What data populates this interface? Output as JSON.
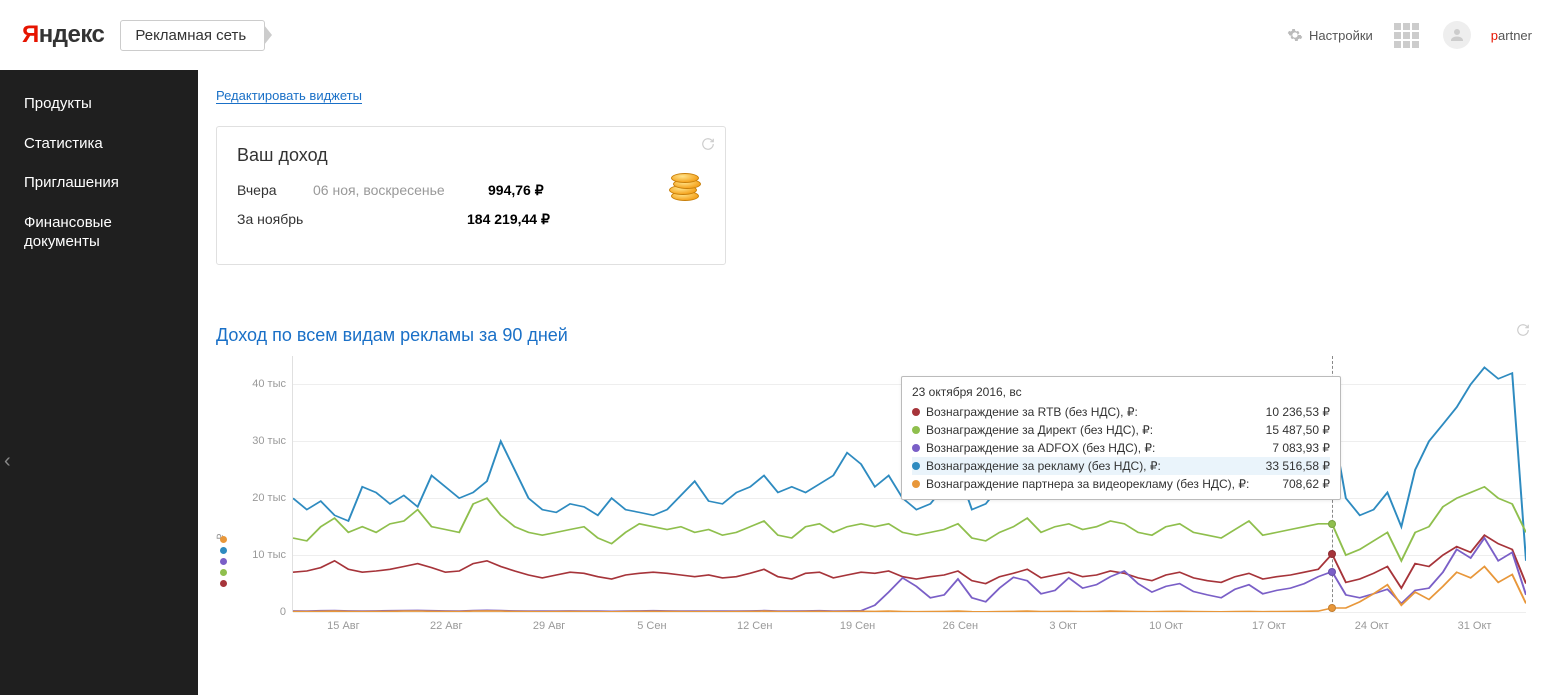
{
  "header": {
    "logo_prefix": "Я",
    "logo_rest": "ндекс",
    "service": "Рекламная сеть",
    "settings_label": "Настройки",
    "username_prefix": "p",
    "username_rest": "artner"
  },
  "sidebar": {
    "items": [
      {
        "label": "Продукты"
      },
      {
        "label": "Статистика"
      },
      {
        "label": "Приглашения"
      },
      {
        "label": "Финансовые документы"
      }
    ]
  },
  "content": {
    "edit_widgets": "Редактировать виджеты",
    "income": {
      "title": "Ваш доход",
      "rows": [
        {
          "label": "Вчера",
          "date": "06 ноя, воскресенье",
          "value": "994,76 ₽"
        },
        {
          "label": "За ноябрь",
          "date": "",
          "value": "184 219,44 ₽"
        }
      ]
    }
  },
  "chart_data": {
    "type": "line",
    "title": "Доход по всем видам рекламы за 90 дней",
    "ylabel": "₽",
    "ylim": [
      0,
      45000
    ],
    "y_ticks": [
      0,
      10000,
      20000,
      30000,
      40000
    ],
    "y_tick_labels": [
      "0",
      "10 тыс",
      "20 тыс",
      "30 тыс",
      "40 тыс"
    ],
    "x_tick_labels": [
      "15 Авг",
      "22 Авг",
      "29 Авг",
      "5 Сен",
      "12 Сен",
      "19 Сен",
      "26 Сен",
      "3 Окт",
      "10 Окт",
      "17 Окт",
      "24 Окт",
      "31 Окт"
    ],
    "hover_index": 75,
    "tooltip": {
      "date": "23 октября 2016, вс",
      "rows": [
        {
          "color": "#a6343a",
          "name": "Вознаграждение за RTB (без НДС), ₽:",
          "value": "10 236,53 ₽"
        },
        {
          "color": "#8fbf4d",
          "name": "Вознаграждение за Директ (без НДС), ₽:",
          "value": "15 487,50 ₽"
        },
        {
          "color": "#7a5fc7",
          "name": "Вознаграждение за ADFOX (без НДС), ₽:",
          "value": "7 083,93 ₽"
        },
        {
          "color": "#2e8bc0",
          "name": "Вознаграждение за рекламу (без НДС), ₽:",
          "value": "33 516,58 ₽",
          "highlight": true
        },
        {
          "color": "#e8973a",
          "name": "Вознаграждение партнера за видеорекламу (без НДС), ₽:",
          "value": "708,62 ₽"
        }
      ]
    },
    "series": [
      {
        "name": "Вознаграждение за рекламу (без НДС)",
        "color": "#2e8bc0",
        "values": [
          20000,
          18000,
          19500,
          17000,
          16000,
          22000,
          21000,
          19000,
          20500,
          18500,
          24000,
          22000,
          20000,
          21000,
          23000,
          30000,
          25000,
          20000,
          18000,
          17500,
          19000,
          18500,
          17000,
          20000,
          18000,
          17500,
          17000,
          18000,
          20500,
          23000,
          19500,
          19000,
          21000,
          22000,
          24000,
          21000,
          22000,
          21000,
          22500,
          24000,
          28000,
          26000,
          22000,
          24000,
          20000,
          18000,
          19000,
          22000,
          25000,
          18000,
          19000,
          22000,
          24500,
          21000,
          20000,
          22000,
          23000,
          28000,
          23000,
          21000,
          22500,
          24000,
          26000,
          21500,
          20500,
          21500,
          24000,
          25000,
          23000,
          22000,
          24000,
          26000,
          25000,
          27000,
          29000,
          33500,
          20000,
          17000,
          18000,
          21000,
          15000,
          25000,
          30000,
          33000,
          36000,
          40000,
          43000,
          41000,
          42000,
          9000
        ]
      },
      {
        "name": "Вознаграждение за Директ (без НДС)",
        "color": "#8fbf4d",
        "values": [
          13000,
          12500,
          15000,
          16500,
          14000,
          15000,
          14000,
          15500,
          16000,
          18000,
          15000,
          14500,
          14000,
          19000,
          20000,
          17000,
          15000,
          14000,
          13500,
          14000,
          14500,
          15000,
          13000,
          12000,
          14000,
          15500,
          15000,
          14500,
          15000,
          14000,
          14500,
          13500,
          14000,
          15000,
          16000,
          13500,
          13000,
          15000,
          15500,
          14000,
          15000,
          15500,
          15000,
          15500,
          14000,
          13500,
          14000,
          14500,
          15500,
          13000,
          12500,
          14000,
          15000,
          16500,
          14000,
          15000,
          15500,
          14500,
          15000,
          16000,
          15500,
          14000,
          13500,
          15000,
          15500,
          14000,
          13500,
          13000,
          14500,
          16000,
          13500,
          14000,
          14500,
          15000,
          15500,
          15500,
          10000,
          11000,
          12500,
          14000,
          9000,
          14000,
          15000,
          18500,
          20000,
          21000,
          22000,
          20000,
          19000,
          14000
        ]
      },
      {
        "name": "Вознаграждение за RTB (без НДС)",
        "color": "#a6343a",
        "values": [
          7000,
          7200,
          7800,
          9000,
          7500,
          7000,
          7200,
          7500,
          8000,
          8500,
          7800,
          7000,
          7200,
          8500,
          9000,
          8000,
          7200,
          6500,
          6000,
          6500,
          7000,
          6800,
          6200,
          5800,
          6500,
          6800,
          7000,
          6800,
          6500,
          6200,
          6500,
          6000,
          6200,
          6800,
          7500,
          6200,
          5800,
          6800,
          7000,
          6000,
          6500,
          7000,
          6800,
          7200,
          6200,
          5800,
          6200,
          6500,
          7200,
          5500,
          5000,
          6200,
          6800,
          7500,
          6000,
          6500,
          7000,
          6200,
          6500,
          7200,
          6800,
          6000,
          5500,
          6500,
          7000,
          6000,
          5500,
          5200,
          6200,
          6800,
          5800,
          6200,
          6500,
          7000,
          7500,
          10200,
          5200,
          5800,
          6800,
          8000,
          4200,
          8500,
          8000,
          10000,
          11500,
          10500,
          13500,
          12000,
          11000,
          5000
        ]
      },
      {
        "name": "Вознаграждение за ADFOX (без НДС)",
        "color": "#7a5fc7",
        "values": [
          200,
          180,
          220,
          250,
          200,
          180,
          200,
          220,
          250,
          280,
          220,
          200,
          180,
          250,
          300,
          250,
          200,
          180,
          150,
          180,
          200,
          180,
          150,
          120,
          180,
          200,
          220,
          200,
          180,
          150,
          180,
          150,
          180,
          200,
          250,
          180,
          150,
          200,
          220,
          180,
          200,
          220,
          1200,
          3500,
          6000,
          4500,
          2500,
          3000,
          5800,
          2500,
          1800,
          4200,
          6100,
          5500,
          3200,
          3800,
          6000,
          4200,
          4800,
          6200,
          7200,
          5000,
          3500,
          4500,
          5000,
          3600,
          3000,
          2500,
          4000,
          4800,
          3200,
          3800,
          4200,
          5000,
          6200,
          7100,
          3000,
          2500,
          3200,
          4000,
          1500,
          3800,
          4200,
          7000,
          11000,
          9500,
          13000,
          9000,
          10500,
          3000
        ]
      },
      {
        "name": "Вознаграждение партнера за видеорекламу (без НДС)",
        "color": "#e8973a",
        "values": [
          100,
          80,
          120,
          150,
          100,
          80,
          100,
          120,
          150,
          180,
          120,
          100,
          80,
          150,
          200,
          150,
          100,
          80,
          60,
          80,
          100,
          80,
          60,
          40,
          80,
          100,
          120,
          100,
          80,
          60,
          80,
          60,
          80,
          100,
          150,
          80,
          60,
          100,
          120,
          80,
          100,
          120,
          100,
          150,
          80,
          60,
          80,
          100,
          150,
          60,
          40,
          80,
          100,
          150,
          80,
          100,
          120,
          80,
          100,
          150,
          120,
          80,
          60,
          100,
          120,
          80,
          60,
          40,
          80,
          100,
          60,
          80,
          100,
          120,
          150,
          710,
          700,
          1800,
          3200,
          4800,
          1200,
          3500,
          2200,
          4500,
          7000,
          6000,
          8000,
          5200,
          6600,
          1500
        ]
      }
    ]
  }
}
